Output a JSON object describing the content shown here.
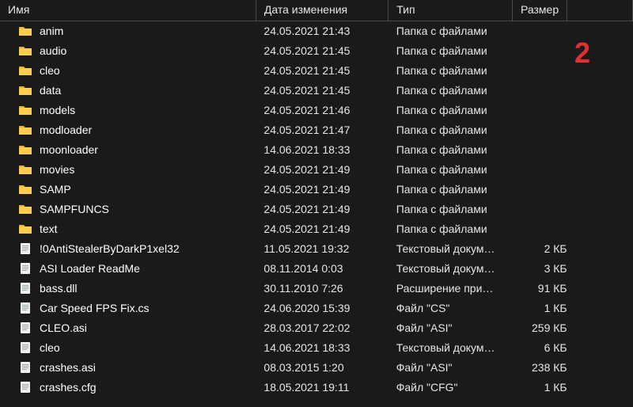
{
  "columns": {
    "name": "Имя",
    "date": "Дата изменения",
    "type": "Тип",
    "size": "Размер"
  },
  "overlay": "2",
  "items": [
    {
      "icon": "folder",
      "name": "anim",
      "date": "24.05.2021 21:43",
      "type": "Папка с файлами",
      "size": ""
    },
    {
      "icon": "folder",
      "name": "audio",
      "date": "24.05.2021 21:45",
      "type": "Папка с файлами",
      "size": ""
    },
    {
      "icon": "folder",
      "name": "cleo",
      "date": "24.05.2021 21:45",
      "type": "Папка с файлами",
      "size": ""
    },
    {
      "icon": "folder",
      "name": "data",
      "date": "24.05.2021 21:45",
      "type": "Папка с файлами",
      "size": ""
    },
    {
      "icon": "folder",
      "name": "models",
      "date": "24.05.2021 21:46",
      "type": "Папка с файлами",
      "size": ""
    },
    {
      "icon": "folder",
      "name": "modloader",
      "date": "24.05.2021 21:47",
      "type": "Папка с файлами",
      "size": ""
    },
    {
      "icon": "folder",
      "name": "moonloader",
      "date": "14.06.2021 18:33",
      "type": "Папка с файлами",
      "size": ""
    },
    {
      "icon": "folder",
      "name": "movies",
      "date": "24.05.2021 21:49",
      "type": "Папка с файлами",
      "size": ""
    },
    {
      "icon": "folder",
      "name": "SAMP",
      "date": "24.05.2021 21:49",
      "type": "Папка с файлами",
      "size": ""
    },
    {
      "icon": "folder",
      "name": "SAMPFUNCS",
      "date": "24.05.2021 21:49",
      "type": "Папка с файлами",
      "size": ""
    },
    {
      "icon": "folder",
      "name": "text",
      "date": "24.05.2021 21:49",
      "type": "Папка с файлами",
      "size": ""
    },
    {
      "icon": "file",
      "name": "!0AntiStealerByDarkP1xel32",
      "date": "11.05.2021 19:32",
      "type": "Текстовый докум…",
      "size": "2 КБ"
    },
    {
      "icon": "file",
      "name": "ASI Loader ReadMe",
      "date": "08.11.2014 0:03",
      "type": "Текстовый докум…",
      "size": "3 КБ"
    },
    {
      "icon": "file",
      "name": "bass.dll",
      "date": "30.11.2010 7:26",
      "type": "Расширение при…",
      "size": "91 КБ"
    },
    {
      "icon": "file",
      "name": "Car Speed FPS Fix.cs",
      "date": "24.06.2020 15:39",
      "type": "Файл \"CS\"",
      "size": "1 КБ"
    },
    {
      "icon": "file",
      "name": "CLEO.asi",
      "date": "28.03.2017 22:02",
      "type": "Файл \"ASI\"",
      "size": "259 КБ"
    },
    {
      "icon": "file",
      "name": "cleo",
      "date": "14.06.2021 18:33",
      "type": "Текстовый докум…",
      "size": "6 КБ"
    },
    {
      "icon": "file",
      "name": "crashes.asi",
      "date": "08.03.2015 1:20",
      "type": "Файл \"ASI\"",
      "size": "238 КБ"
    },
    {
      "icon": "file",
      "name": "crashes.cfg",
      "date": "18.05.2021 19:11",
      "type": "Файл \"CFG\"",
      "size": "1 КБ"
    }
  ]
}
